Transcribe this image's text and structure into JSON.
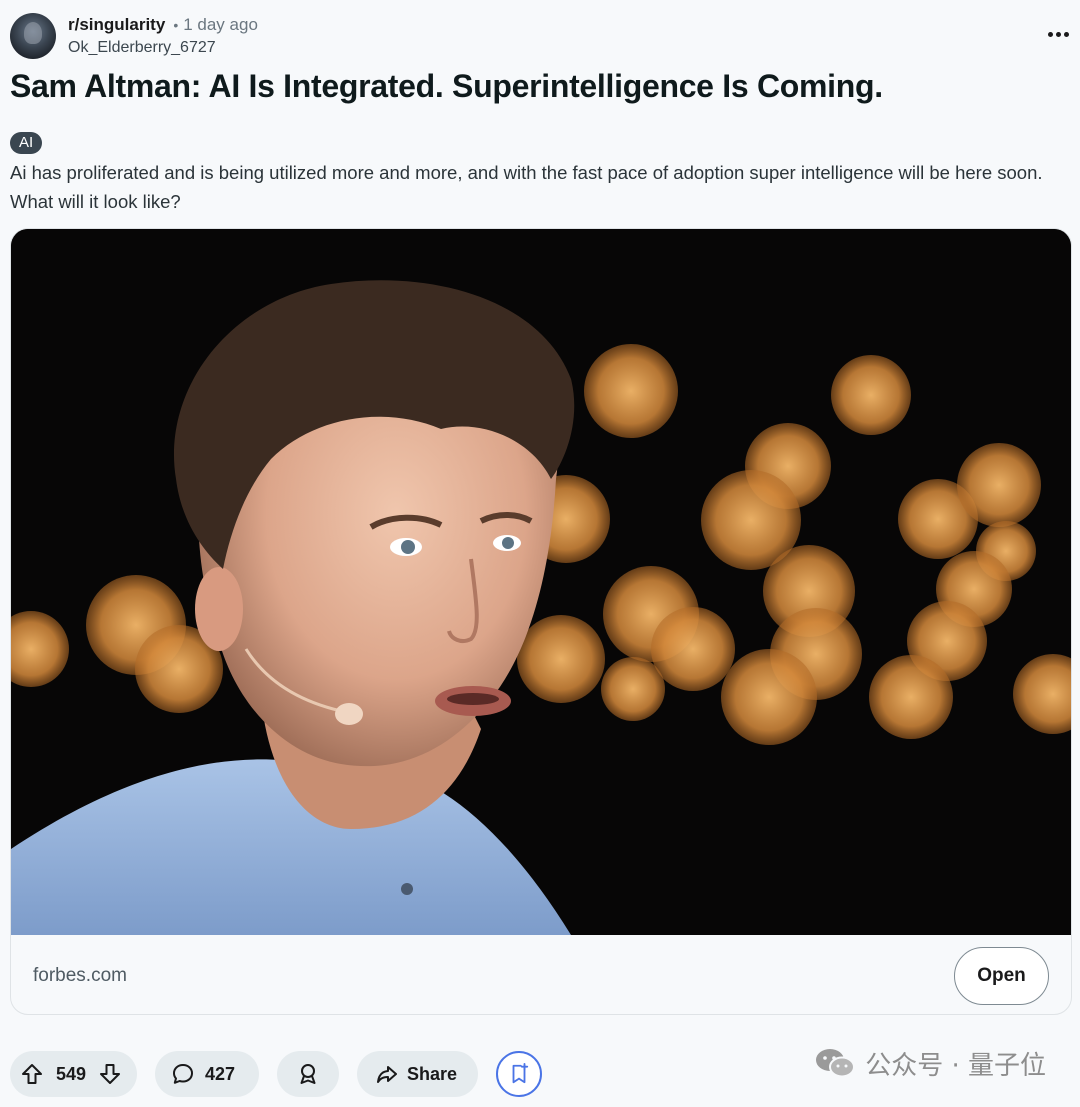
{
  "post": {
    "subreddit": "r/singularity",
    "separator": "•",
    "time_ago": "1 day ago",
    "username": "Ok_Elderberry_6727",
    "title": "Sam Altman: AI Is Integrated. Superintelligence Is Coming.",
    "flair": "AI",
    "body": "Ai has proliferated and is being utilized more and more, and with the fast pace of adoption super intelligence will be here soon. What will it look like?"
  },
  "link_card": {
    "domain": "forbes.com",
    "open_label": "Open"
  },
  "actions": {
    "upvotes": "549",
    "comments": "427",
    "share_label": "Share"
  },
  "watermark": {
    "text": "公众号 · 量子位"
  },
  "icons": {
    "avatar": "avatar",
    "overflow": "more-horizontal-icon",
    "upvote": "arrow-up-icon",
    "downvote": "arrow-down-icon",
    "comment": "comment-bubble-icon",
    "award": "award-ribbon-icon",
    "share": "share-arrow-icon",
    "save": "bookmark-plus-icon",
    "watermark_logo": "wechat-icon"
  },
  "colors": {
    "page_bg": "#f7f9fb",
    "pill_bg": "#e5ebee",
    "flair_bg": "#3a4650",
    "save_accent": "#4a74e6"
  }
}
